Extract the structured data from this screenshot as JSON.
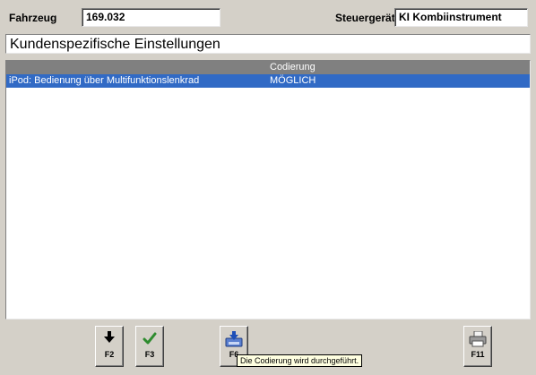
{
  "header": {
    "vehicle_label": "Fahrzeug",
    "vehicle_value": "169.032",
    "ecu_label": "Steuergerät",
    "ecu_value": "KI Kombiinstrument"
  },
  "section_title": "Kundenspezifische Einstellungen",
  "table": {
    "columns": [
      "",
      "Codierung"
    ],
    "rows": [
      {
        "name": "iPod: Bedienung über Multifunktionslenkrad",
        "coding": "MÖGLICH",
        "selected": true
      }
    ]
  },
  "toolbar": {
    "buttons": [
      {
        "key": "F2",
        "icon": "arrow-down-icon"
      },
      {
        "key": "F3",
        "icon": "checkmark-icon"
      },
      {
        "key": "F6",
        "icon": "download-disk-icon"
      },
      {
        "key": "F11",
        "icon": "printer-icon"
      }
    ],
    "tooltip": "Die Codierung wird durchgeführt."
  },
  "colors": {
    "background": "#d4d0c8",
    "header_row": "#808080",
    "selection": "#316ac5",
    "check": "#2e8b2e",
    "tooltip_bg": "#ffffe1"
  }
}
